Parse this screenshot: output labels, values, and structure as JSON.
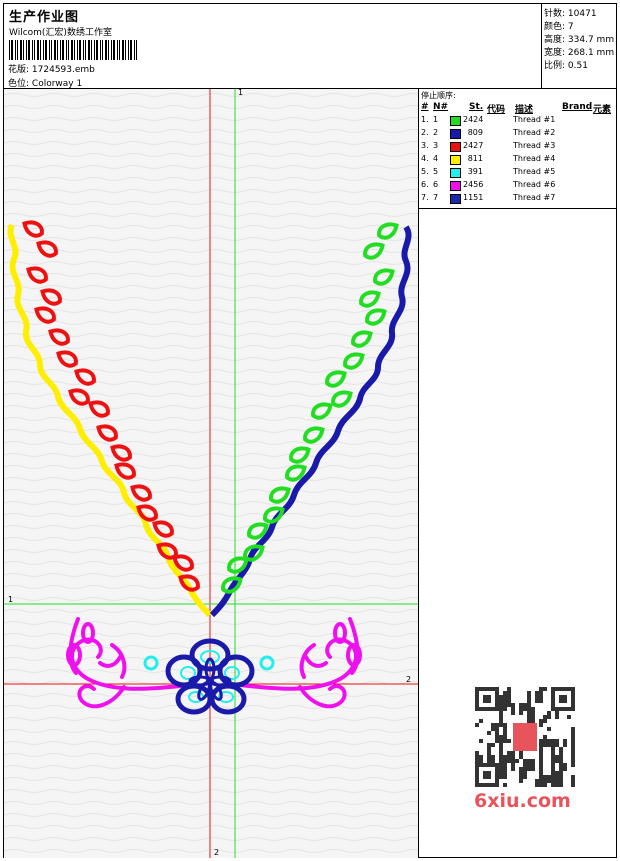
{
  "header": {
    "title": "生产作业图",
    "company": "Wilcom(汇宏)数绣工作室",
    "design_label": "花版:",
    "design_value": "1724593.emb",
    "colorway_label": "色位:",
    "colorway_value": "Colorway 1"
  },
  "info": [
    {
      "label": "针数:",
      "value": "10471"
    },
    {
      "label": "颜色:",
      "value": "7"
    },
    {
      "label": "高度:",
      "value": "334.7 mm"
    },
    {
      "label": "宽度:",
      "value": "268.1 mm"
    },
    {
      "label": "比例:",
      "value": "0.51"
    }
  ],
  "thread_panel": {
    "title": "停止顺序:",
    "headers": {
      "n": "#",
      "num": "N#",
      "st": "St.",
      "code": "代码",
      "desc": "描述",
      "brand": "Brand",
      "elem": "元素"
    },
    "rows": [
      {
        "n": "1.",
        "num": "1",
        "color": "#22dd22",
        "code": "2424",
        "desc": "Thread #1"
      },
      {
        "n": "2.",
        "num": "2",
        "color": "#1a1aaa",
        "code": "809",
        "desc": "Thread #2"
      },
      {
        "n": "3.",
        "num": "3",
        "color": "#ee1111",
        "code": "2427",
        "desc": "Thread #3"
      },
      {
        "n": "4.",
        "num": "4",
        "color": "#ffee00",
        "code": "811",
        "desc": "Thread #4"
      },
      {
        "n": "5.",
        "num": "5",
        "color": "#22eeee",
        "code": "391",
        "desc": "Thread #5"
      },
      {
        "n": "6.",
        "num": "6",
        "color": "#ee11ee",
        "code": "2456",
        "desc": "Thread #6"
      },
      {
        "n": "7.",
        "num": "7",
        "color": "#1a2aaa",
        "code": "1151",
        "desc": "Thread #7"
      }
    ]
  },
  "axis_labels": {
    "green_v": "1",
    "green_h": "1",
    "red_h": "2",
    "red_v": "2"
  },
  "watermark": "6xiu.com"
}
